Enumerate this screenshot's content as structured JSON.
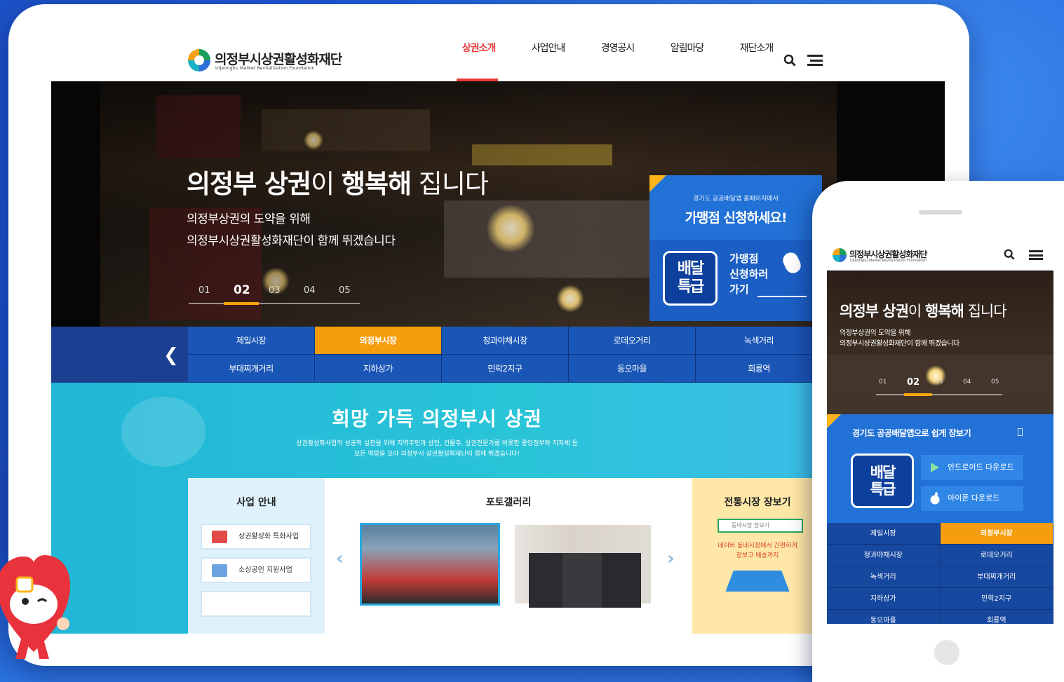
{
  "brand": {
    "name_ko": "의정부시상권활성화재단",
    "name_en": "Uijeongbu Market Revitalization Foundation"
  },
  "nav": {
    "items": [
      "상권소개",
      "사업안내",
      "경영공시",
      "알림마당",
      "재단소개"
    ],
    "active": "상권소개"
  },
  "hero": {
    "title_bold": "의정부 상권",
    "title_mid": "이 ",
    "title_bold2": "행복해",
    "title_end": " 집니다",
    "sub1": "의정부상권의 도약을 위해",
    "sub2": "의정부시상권활성화재단이 함께 뛰겠습니다",
    "pager": [
      "01",
      "02",
      "03",
      "04",
      "05"
    ],
    "active_page": "02"
  },
  "promo": {
    "small": "경기도 공공배달앱 홈페이지에서",
    "headline": "가맹점 신청하세요!",
    "logo_text": "배달특급",
    "go1": "가맹점",
    "go2": "신청하러",
    "go3": "가기"
  },
  "markets": {
    "row1": [
      "제일시장",
      "의정부시장",
      "청과야채시장",
      "로데오거리",
      "녹색거리"
    ],
    "row2": [
      "부대찌개거리",
      "지하상가",
      "민락2지구",
      "동오마을",
      "회룡역"
    ],
    "active": "의정부시장"
  },
  "section": {
    "title": "희망 가득 의정부시 상권",
    "desc1": "상권활성화사업의 성공적 실천을 위해 지역주민과 상인, 건물주, 상권전문가를 비롯한 중앙정부와 지자체 등",
    "desc2": "모든 역량을 모아 의정부시 상권활성화재단이 함께 뛰겠습니다!"
  },
  "biz": {
    "title": "사업 안내",
    "items": [
      "상권활성화 특화사업",
      "소상공인 지원사업"
    ]
  },
  "gallery": {
    "title": "포토갤러리"
  },
  "shop": {
    "title": "전통시장 장보기",
    "search_placeholder": "동네시장 장보기",
    "text1": "네이버 동네시장에서 간편하게",
    "text2": "장보고 배송까지"
  },
  "mobile": {
    "promo_title": "경기도 공공배달앱으로 쉽게 장보기",
    "android": "안드로이드 다운로드",
    "ios": "아이폰 다운로드",
    "grid": [
      "제일시장",
      "의정부시장",
      "청과야채시장",
      "로데오거리",
      "녹색거리",
      "부대찌개거리",
      "지하상가",
      "민락2지구",
      "동오마을",
      "회룡역"
    ],
    "active": "의정부시장"
  },
  "colors": {
    "accent_red": "#e83a3a",
    "orange": "#f59d0d",
    "navy": "#17489f",
    "teal": "#22b6d7",
    "promo_blue": "#2271d6"
  }
}
